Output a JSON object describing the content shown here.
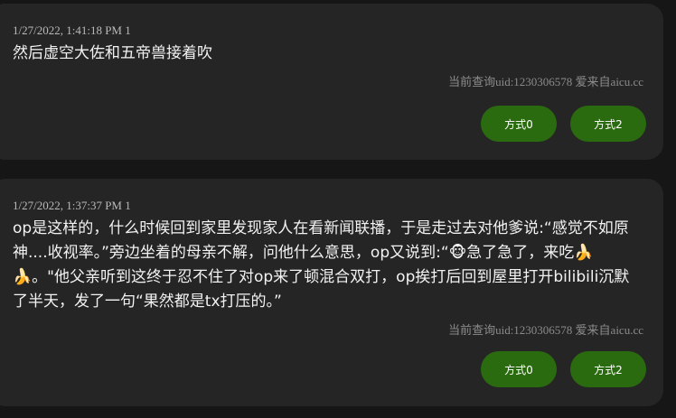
{
  "posts": [
    {
      "meta": "1/27/2022, 1:41:18 PM 1",
      "content": "然后虚空大佐和五帝兽接着吹",
      "uid_line": "当前查询uid:1230306578 爱来自aicu.cc",
      "actions": [
        "方式0",
        "方式2"
      ]
    },
    {
      "meta": "1/27/2022, 1:37:37 PM 1",
      "content": "op是这样的，什么时候回到家里发现家人在看新闻联播，于是走过去对他爹说:“感觉不如原神....收视率。”旁边坐着的母亲不解，问他什么意思，op又说到:“🐵急了急了，来吃🍌🍌。\"他父亲听到这终于忍不住了对op来了顿混合双打，op挨打后回到屋里打开bilibili沉默了半天，发了一句“果然都是tx打压的。”",
      "uid_line": "当前查询uid:1230306578 爱来自aicu.cc",
      "actions": [
        "方式0",
        "方式2"
      ]
    }
  ],
  "colors": {
    "background": "#161616",
    "card": "#252525",
    "button": "#2b6b0f",
    "text": "#f2f2f2",
    "meta": "#b9b9b9",
    "uid": "#8b8b8b"
  }
}
